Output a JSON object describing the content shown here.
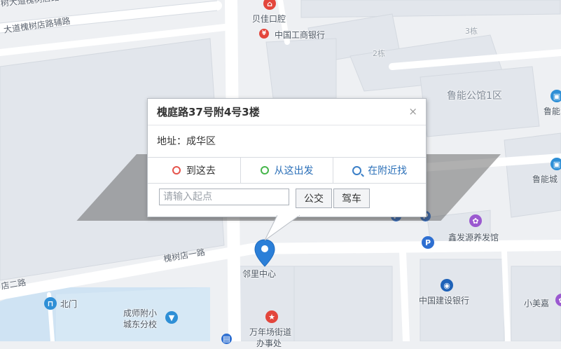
{
  "popup": {
    "title": "槐庭路37号附4号3楼",
    "close": "×",
    "address": "地址：成华区",
    "tabs": [
      {
        "label": "到这去"
      },
      {
        "label": "从这出发"
      },
      {
        "label": "在附近找"
      }
    ],
    "input_placeholder": "请输入起点",
    "bus_button": "公交",
    "drive_button": "驾车"
  },
  "map_labels": {
    "road_top1": "树大道槐树店路",
    "road_top2": "大道槐树店路辅路",
    "road_middle": "槐树店一路",
    "road_bottom_left": "店二路",
    "poi_dental": "贝佳口腔",
    "poi_icbc": "中国工商银行",
    "bld_3": "3栋",
    "bld_2": "2栋",
    "poi_luneng1": "鲁能公馆1区",
    "poi_luneng_right": "鲁能",
    "poi_luneng_right2": "鲁能城",
    "poi_xinfa": "鑫发源养发馆",
    "poi_center": "邻里中心",
    "poi_ccb": "中国建设银行",
    "poi_xiaomei": "小美嘉",
    "poi_north_gate": "北门",
    "poi_school_1": "成师附小",
    "poi_school_2": "城东分校",
    "poi_wannian_1": "万年场街道",
    "poi_wannian_2": "办事处"
  },
  "colors": {
    "land": "#eef0f3",
    "block": "#e4e7ec",
    "road": "#ffffff",
    "water": "#d5e6f4",
    "marker": "#2b7fd8",
    "pin_red": "#e3463c"
  },
  "icons": [
    "dental-pin-icon",
    "bank-icon",
    "building-icon",
    "purple-poi-icon",
    "parking-icon",
    "bank-ccb-icon",
    "gate-icon",
    "school-icon",
    "government-icon",
    "location-marker-icon"
  ]
}
